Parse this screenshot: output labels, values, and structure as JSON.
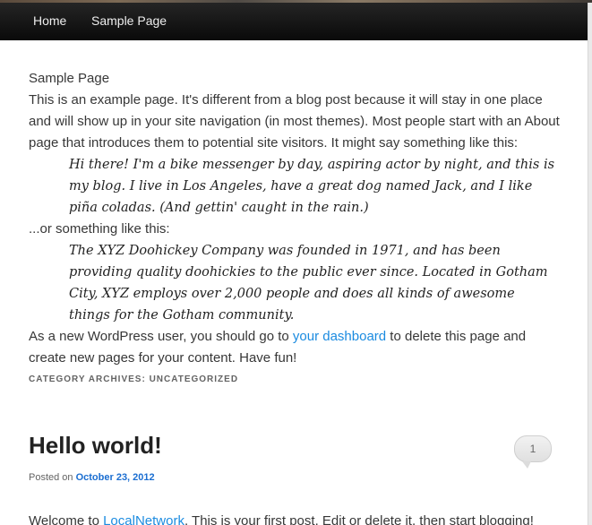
{
  "nav": {
    "home": "Home",
    "sample": "Sample Page"
  },
  "page": {
    "title": "Sample Page",
    "intro_lines": [
      "This is an example page. It's different from a blog post because it will stay in one place",
      "and will show up in your site navigation (in most themes). Most people start with an About",
      "page that introduces them to potential site visitors. It might say something like this:"
    ],
    "quote1_lines": [
      "Hi there! I'm a bike messenger by day, aspiring actor by night, and this is",
      "my blog. I live in Los Angeles, have a great dog named Jack, and I like",
      "piña coladas. (And gettin' caught in the rain.)"
    ],
    "or_line": "...or something like this:",
    "quote2_lines": [
      "The XYZ Doohickey Company was founded in 1971, and has been",
      "providing quality doohickies to the public ever since. Located in Gotham",
      "City, XYZ employs over 2,000 people and does all kinds of awesome",
      "things for the Gotham community."
    ],
    "closing_prefix": "As a new WordPress user, you should go to ",
    "dashboard_link": "your dashboard",
    "closing_suffix": " to delete this page and",
    "closing_line2": "create new pages for your content. Have fun!"
  },
  "archive": {
    "title": "Category Archives: Uncategorized"
  },
  "post": {
    "title": "Hello world!",
    "comment_count": "1",
    "posted_prefix": "Posted on ",
    "date": "October 23, 2012",
    "excerpt_prefix": "Welcome to ",
    "excerpt_link": "LocalNetwork",
    "excerpt_suffix": ". This is your first post. Edit or delete it, then start blogging!"
  }
}
